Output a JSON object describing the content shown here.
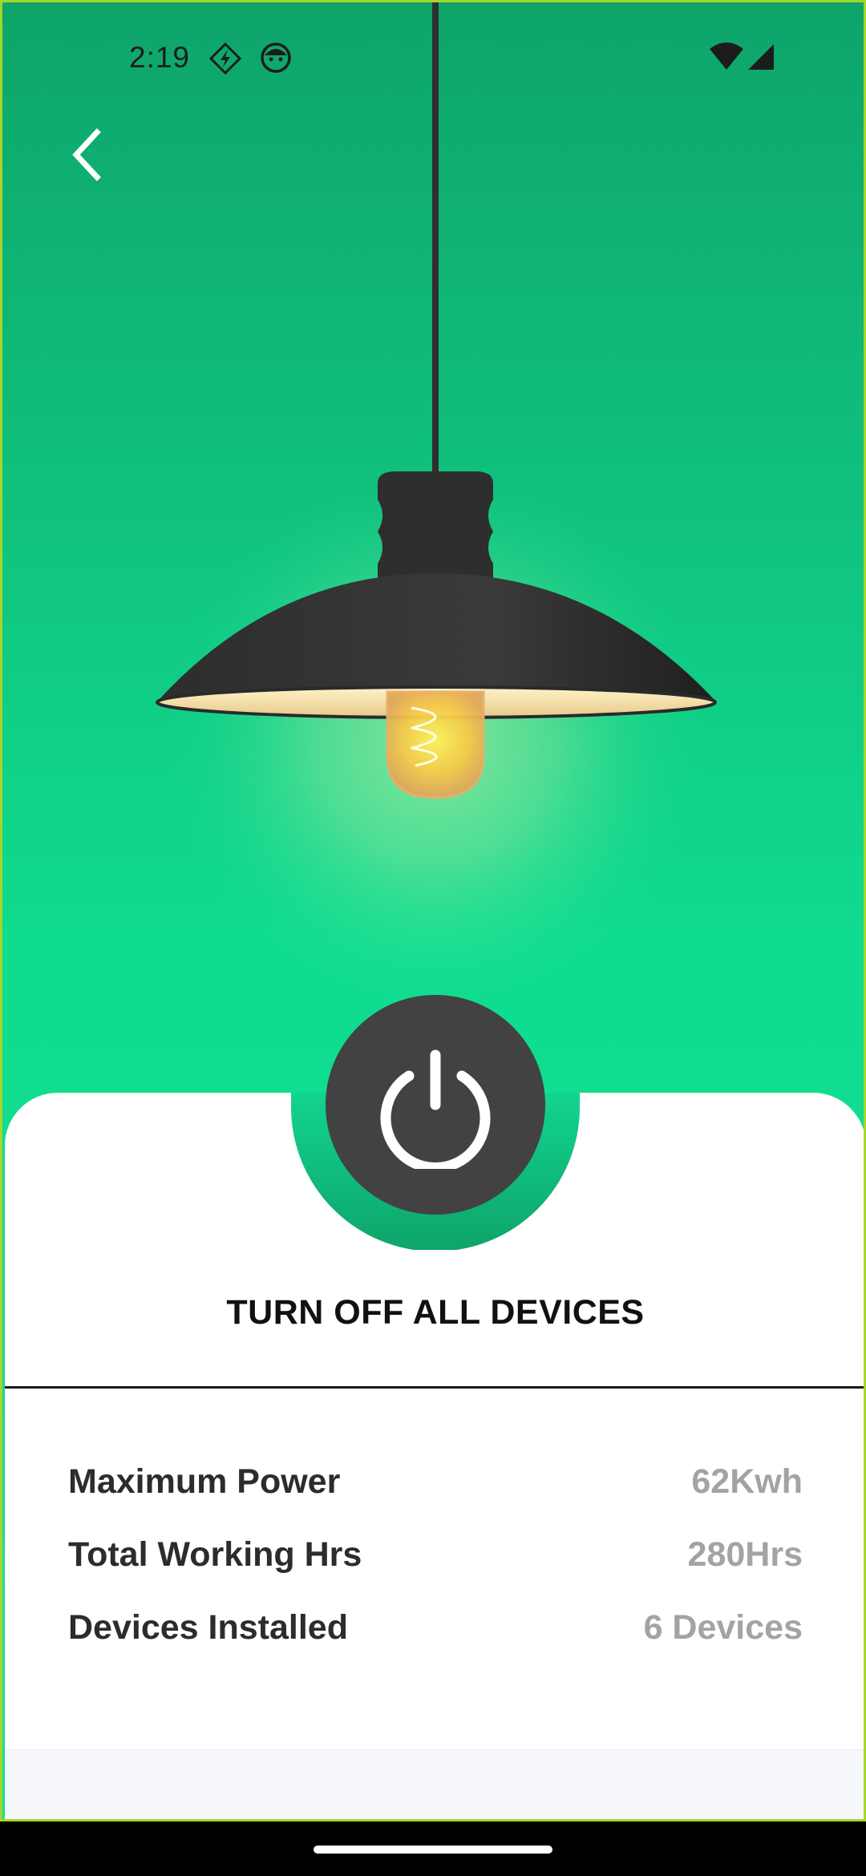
{
  "status_bar": {
    "time": "2:19",
    "icons": [
      "flash-badge-icon",
      "face-icon",
      "wifi-icon",
      "cell-signal-icon"
    ]
  },
  "header": {
    "back_icon": "chevron-left-icon"
  },
  "colors": {
    "accent_green": "#10dc8f",
    "power_button": "#424242",
    "value_gray": "#a3a3a3"
  },
  "control": {
    "power_icon": "power-icon",
    "title": "TURN OFF ALL DEVICES"
  },
  "stats": [
    {
      "label": "Maximum Power",
      "value": "62Kwh"
    },
    {
      "label": "Total Working Hrs",
      "value": "280Hrs"
    },
    {
      "label": "Devices Installed",
      "value": "6 Devices"
    }
  ]
}
